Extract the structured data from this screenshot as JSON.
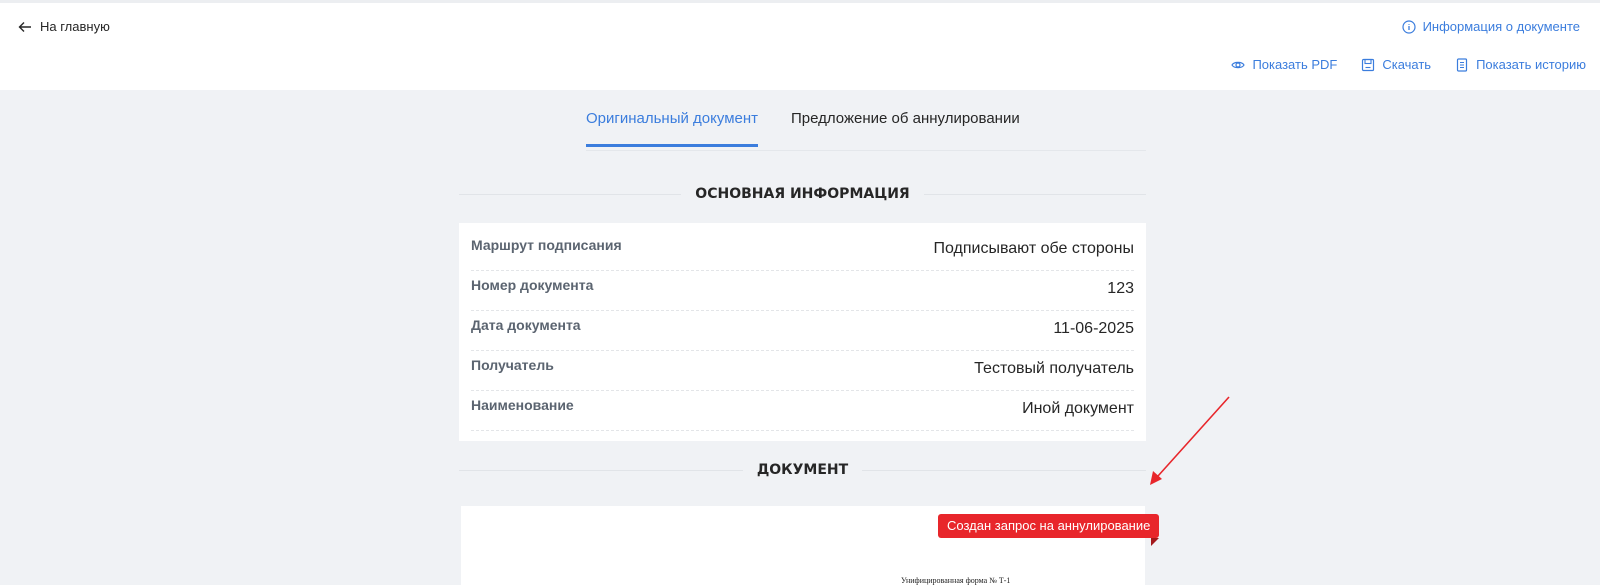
{
  "header": {
    "back_label": "На главную",
    "info_label": "Информация о документе",
    "actions": {
      "show_pdf": "Показать PDF",
      "download": "Скачать",
      "show_history": "Показать историю"
    }
  },
  "tabs": {
    "original": "Оригинальный документ",
    "cancellation": "Предложение об аннулировании"
  },
  "sections": {
    "main_info": "ОСНОВНАЯ ИНФОРМАЦИЯ",
    "document": "ДОКУМЕНТ"
  },
  "info_rows": [
    {
      "label": "Маршрут подписания",
      "value": "Подписывают обе стороны"
    },
    {
      "label": "Номер документа",
      "value": "123"
    },
    {
      "label": "Дата документа",
      "value": "11-06-2025"
    },
    {
      "label": "Получатель",
      "value": "Тестовый получатель"
    },
    {
      "label": "Наименование",
      "value": "Иной документ"
    }
  ],
  "document": {
    "status_badge": "Создан запрос на аннулирование",
    "form_text": "Унифицированная форма № Т-1"
  },
  "colors": {
    "accent": "#3b7ddd",
    "badge": "#e8262b",
    "annotation_arrow": "#e8262b"
  }
}
